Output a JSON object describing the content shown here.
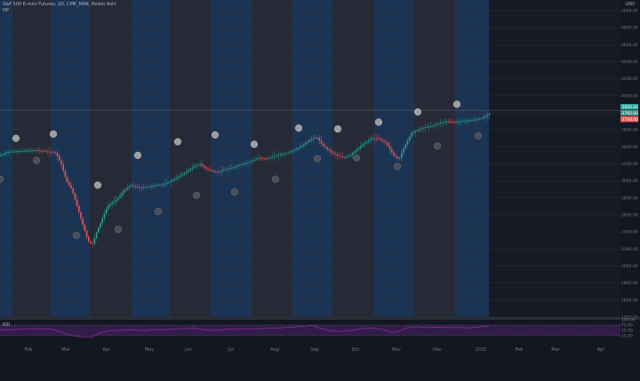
{
  "legend": {
    "symbol_line": "S&P 500 E-mini Futures, 1D, CME_MINI, Heikin Ashi",
    "indicator": "HP"
  },
  "currency_label": "USD",
  "rsi_label": "RSI",
  "colors": {
    "bg": "#131722",
    "up": "#26a69a",
    "down": "#ef5350",
    "band_blue": "#1e3a5c",
    "band_gray": "#2a2e39",
    "rsi": "#9c27b0",
    "rsi_fill": "#3a1f52"
  },
  "chart_data": {
    "type": "candlestick",
    "price_axis": {
      "min": 1400,
      "max": 5000,
      "ticks": [
        "5000.00",
        "4800.00",
        "4600.00",
        "4400.00",
        "4200.00",
        "4000.00",
        "3800.00",
        "3600.00",
        "3400.00",
        "3200.00",
        "3000.00",
        "2800.00",
        "2600.00",
        "2400.00",
        "2200.00",
        "2000.00",
        "1800.00",
        "1600.00",
        "1400.00"
      ]
    },
    "x_axis": {
      "ticks": [
        "Feb",
        "Mar",
        "Apr",
        "May",
        "Jun",
        "Jul",
        "Aug",
        "Sep",
        "Oct",
        "Nov",
        "Dec",
        "2021",
        "Feb",
        "Mar",
        "Apr"
      ]
    },
    "last_price_badges": [
      "3800.00",
      "3760.00",
      "3740.00"
    ],
    "rsi_axis": {
      "ticks": [
        "100.00",
        "75.00",
        "50.00",
        "25.00"
      ]
    },
    "series_path": [
      [
        0,
        3300
      ],
      [
        8,
        3340
      ],
      [
        20,
        3350
      ],
      [
        40,
        3360
      ],
      [
        55,
        3340
      ],
      [
        62,
        3330
      ],
      [
        68,
        3200
      ],
      [
        74,
        3000
      ],
      [
        80,
        2900
      ],
      [
        86,
        2700
      ],
      [
        92,
        2500
      ],
      [
        98,
        2300
      ],
      [
        103,
        2250
      ],
      [
        108,
        2400
      ],
      [
        114,
        2550
      ],
      [
        120,
        2700
      ],
      [
        126,
        2750
      ],
      [
        132,
        2800
      ],
      [
        138,
        2880
      ],
      [
        146,
        2950
      ],
      [
        156,
        2920
      ],
      [
        166,
        2930
      ],
      [
        176,
        2950
      ],
      [
        184,
        2960
      ],
      [
        192,
        3000
      ],
      [
        200,
        3050
      ],
      [
        208,
        3100
      ],
      [
        216,
        3160
      ],
      [
        224,
        3200
      ],
      [
        230,
        3150
      ],
      [
        236,
        3120
      ],
      [
        244,
        3100
      ],
      [
        252,
        3130
      ],
      [
        262,
        3160
      ],
      [
        272,
        3200
      ],
      [
        282,
        3230
      ],
      [
        290,
        3270
      ],
      [
        300,
        3260
      ],
      [
        310,
        3300
      ],
      [
        320,
        3320
      ],
      [
        330,
        3360
      ],
      [
        340,
        3420
      ],
      [
        350,
        3500
      ],
      [
        356,
        3510
      ],
      [
        362,
        3420
      ],
      [
        370,
        3350
      ],
      [
        378,
        3300
      ],
      [
        386,
        3270
      ],
      [
        394,
        3310
      ],
      [
        402,
        3380
      ],
      [
        410,
        3450
      ],
      [
        418,
        3500
      ],
      [
        426,
        3490
      ],
      [
        434,
        3440
      ],
      [
        442,
        3300
      ],
      [
        448,
        3250
      ],
      [
        454,
        3400
      ],
      [
        462,
        3560
      ],
      [
        470,
        3600
      ],
      [
        478,
        3630
      ],
      [
        486,
        3650
      ],
      [
        494,
        3680
      ],
      [
        502,
        3700
      ],
      [
        510,
        3690
      ],
      [
        518,
        3700
      ],
      [
        526,
        3710
      ],
      [
        534,
        3720
      ],
      [
        542,
        3740
      ],
      [
        550,
        3790
      ]
    ],
    "markers_above": [
      [
        18,
        3500
      ],
      [
        60,
        3550
      ],
      [
        110,
        2950
      ],
      [
        155,
        3300
      ],
      [
        200,
        3460
      ],
      [
        242,
        3540
      ],
      [
        286,
        3430
      ],
      [
        336,
        3620
      ],
      [
        380,
        3610
      ],
      [
        426,
        3690
      ],
      [
        470,
        3810
      ],
      [
        514,
        3900
      ]
    ],
    "markers_below": [
      [
        0,
        3020
      ],
      [
        41,
        3240
      ],
      [
        86,
        2360
      ],
      [
        133,
        2430
      ],
      [
        178,
        2640
      ],
      [
        221,
        2830
      ],
      [
        264,
        2870
      ],
      [
        310,
        3020
      ],
      [
        357,
        3260
      ],
      [
        401,
        3270
      ],
      [
        447,
        3170
      ],
      [
        492,
        3410
      ],
      [
        538,
        3530
      ]
    ],
    "rsi_series": [
      [
        0,
        52
      ],
      [
        20,
        55
      ],
      [
        40,
        58
      ],
      [
        55,
        57
      ],
      [
        62,
        52
      ],
      [
        70,
        40
      ],
      [
        78,
        30
      ],
      [
        86,
        22
      ],
      [
        96,
        18
      ],
      [
        104,
        20
      ],
      [
        112,
        38
      ],
      [
        122,
        48
      ],
      [
        134,
        50
      ],
      [
        146,
        52
      ],
      [
        160,
        49
      ],
      [
        176,
        53
      ],
      [
        190,
        55
      ],
      [
        204,
        58
      ],
      [
        218,
        60
      ],
      [
        230,
        52
      ],
      [
        242,
        50
      ],
      [
        256,
        55
      ],
      [
        270,
        58
      ],
      [
        286,
        56
      ],
      [
        300,
        60
      ],
      [
        316,
        62
      ],
      [
        332,
        66
      ],
      [
        344,
        70
      ],
      [
        352,
        74
      ],
      [
        360,
        60
      ],
      [
        372,
        48
      ],
      [
        384,
        45
      ],
      [
        396,
        50
      ],
      [
        408,
        58
      ],
      [
        418,
        62
      ],
      [
        430,
        55
      ],
      [
        442,
        40
      ],
      [
        450,
        46
      ],
      [
        458,
        62
      ],
      [
        468,
        67
      ],
      [
        480,
        63
      ],
      [
        492,
        65
      ],
      [
        504,
        63
      ],
      [
        516,
        64
      ],
      [
        528,
        62
      ],
      [
        540,
        66
      ],
      [
        550,
        70
      ]
    ]
  }
}
